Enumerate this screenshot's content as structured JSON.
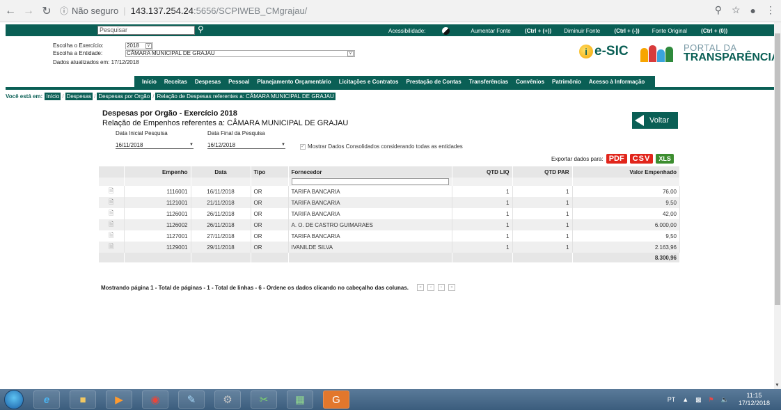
{
  "browser": {
    "url_info": "Não seguro",
    "url_host": "143.137.254.24",
    "url_path": ":5656/SCPIWEB_CMgrajau/"
  },
  "topbar": {
    "search_placeholder": "Pesquisar",
    "accessibility": "Acessibilidade:",
    "increase_font_prefix": "Aumentar Fonte",
    "increase_font_key": "(Ctrl + (+))",
    "decrease_font_prefix": "Diminuir Fonte",
    "decrease_font_key": "(Ctrl + (-))",
    "original_font_prefix": "Fonte Original",
    "original_font_key": "(Ctrl + (0))"
  },
  "filters": {
    "exercicio_label": "Escolha o Exercício:",
    "exercicio_value": "2018",
    "entidade_label": "Escolha a Entidade:",
    "entidade_value": "CÂMARA MUNICIPAL DE GRAJAU",
    "updated": "Dados atualizados em: 17/12/2018"
  },
  "logos": {
    "esic": "e-SIC",
    "esic_letter": "i",
    "portal_line1": "PORTAL DA",
    "portal_line2": "TRANSPARÊNCIA"
  },
  "menu": [
    "Início",
    "Receitas",
    "Despesas",
    "Pessoal",
    "Planejamento Orçamentário",
    "Licitações e Contratos",
    "Prestação de Contas",
    "Transferências",
    "Convênios",
    "Patrimônio",
    "Acesso à Informação"
  ],
  "breadcrumb": {
    "label": "Você está em:",
    "items": [
      "Início",
      "Despesas",
      "Despesas por Orgão",
      "Relação de Despesas referentes a: CÂMARA MUNICIPAL DE GRAJAU"
    ]
  },
  "content": {
    "title": "Despesas por Orgão - Exercício 2018",
    "subtitle": "Relação de Empenhos referentes a: CÂMARA MUNICIPAL DE GRAJAU",
    "back_button": "Voltar",
    "date_start_label": "Data Inicial Pesquisa",
    "date_start": "16/11/2018",
    "date_end_label": "Data Final da Pesquisa",
    "date_end": "16/12/2018",
    "consolidated": "Mostrar Dados Consolidados considerando todas as entidades",
    "export_label": "Exportar dados para:",
    "export_pdf": "PDF",
    "export_csv": "CSV",
    "export_xls": "XLS"
  },
  "table": {
    "headers": [
      "Empenho",
      "Data",
      "Tipo",
      "Fornecedor",
      "QTD LIQ",
      "QTD PAR",
      "Valor Empenhado"
    ],
    "rows": [
      [
        "1116001",
        "16/11/2018",
        "OR",
        "TARIFA BANCARIA",
        "1",
        "1",
        "76,00"
      ],
      [
        "1121001",
        "21/11/2018",
        "OR",
        "TARIFA BANCARIA",
        "1",
        "1",
        "9,50"
      ],
      [
        "1126001",
        "26/11/2018",
        "OR",
        "TARIFA BANCARIA",
        "1",
        "1",
        "42,00"
      ],
      [
        "1126002",
        "26/11/2018",
        "OR",
        "A. O. DE CASTRO GUIMARAES",
        "1",
        "1",
        "6.000,00"
      ],
      [
        "1127001",
        "27/11/2018",
        "OR",
        "TARIFA BANCARIA",
        "1",
        "1",
        "9,50"
      ],
      [
        "1129001",
        "29/11/2018",
        "OR",
        "IVANILDE SILVA",
        "1",
        "1",
        "2.163,96"
      ]
    ],
    "total": "8.300,96"
  },
  "pager": {
    "text": "Mostrando página 1 - Total de páginas - 1 - Total de linhas - 6 - Ordene os dados clicando no cabeçalho das colunas."
  },
  "taskbar": {
    "lang": "PT",
    "time": "11:15",
    "date": "17/12/2018"
  },
  "colors": {
    "brand_green": "#0a5f55",
    "pdf_red": "#e1251b",
    "xls_green": "#3c8d2f"
  }
}
